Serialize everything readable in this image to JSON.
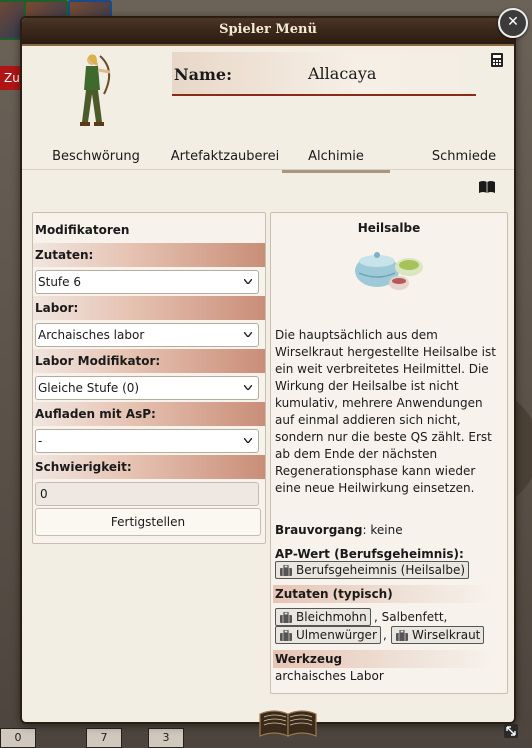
{
  "background": {
    "red_label": "Zu",
    "bottom_tokens": [
      "0",
      "7",
      "3"
    ]
  },
  "dialog": {
    "title": "Spieler Menü",
    "close_glyph": "✕",
    "name_label": "Name:",
    "name_value": "Allacaya"
  },
  "tabs": [
    {
      "label": "Beschwörung"
    },
    {
      "label": "Artefaktzauberei"
    },
    {
      "label": "Alchimie",
      "active": true
    },
    {
      "label": "Schmiede"
    }
  ],
  "left": {
    "heading": "Modifikatoren",
    "fields": {
      "zutaten_label": "Zutaten:",
      "zutaten_value": "Stufe 6",
      "labor_label": "Labor:",
      "labor_value": "Archaisches labor",
      "labor_mod_label": "Labor Modifikator:",
      "labor_mod_value": "Gleiche Stufe (0)",
      "aufladen_label": "Aufladen mit AsP:",
      "aufladen_value": "-",
      "schwierigkeit_label": "Schwierigkeit:",
      "schwierigkeit_value": "0"
    },
    "finish_button": "Fertigstellen"
  },
  "right": {
    "title": "Heilsalbe",
    "description": "Die hauptsächlich aus dem Wirselkraut hergestellte Heilsalbe ist ein weit verbreitetes Heilmittel. Die Wirkung der Heilsalbe ist nicht kumulativ, mehrere Anwendungen auf einmal addieren sich nicht, sondern nur die beste QS zählt. Erst ab dem Ende der nächsten Regenerationsphase kann wieder eine neue Heilwirkung einsetzen.",
    "brauvorgang_label": "Brauvorgang",
    "brauvorgang_value": ": keine",
    "ap_label": "AP-Wert (Berufsgeheimnis):",
    "ap_chip": "Berufsgeheimnis (Heilsalbe)",
    "zutaten_label": "Zutaten (typisch)",
    "zutaten_chip_1": "Bleichmohn",
    "zutaten_text_1": ", Salbenfett,",
    "zutaten_chip_2": "Ulmenwürger",
    "zutaten_text_2": ",",
    "zutaten_chip_3": "Wirselkraut",
    "werkzeug_label": "Werkzeug",
    "werkzeug_value": "archaisches Labor"
  },
  "colors": {
    "accent": "#8a2b1a",
    "titlebar": "#3a2819",
    "panel": "#f7f3ec"
  },
  "icons": [
    "close-icon",
    "calculator-icon",
    "book-icon",
    "chevron-down-icon",
    "bag-icon",
    "resize-icon"
  ]
}
